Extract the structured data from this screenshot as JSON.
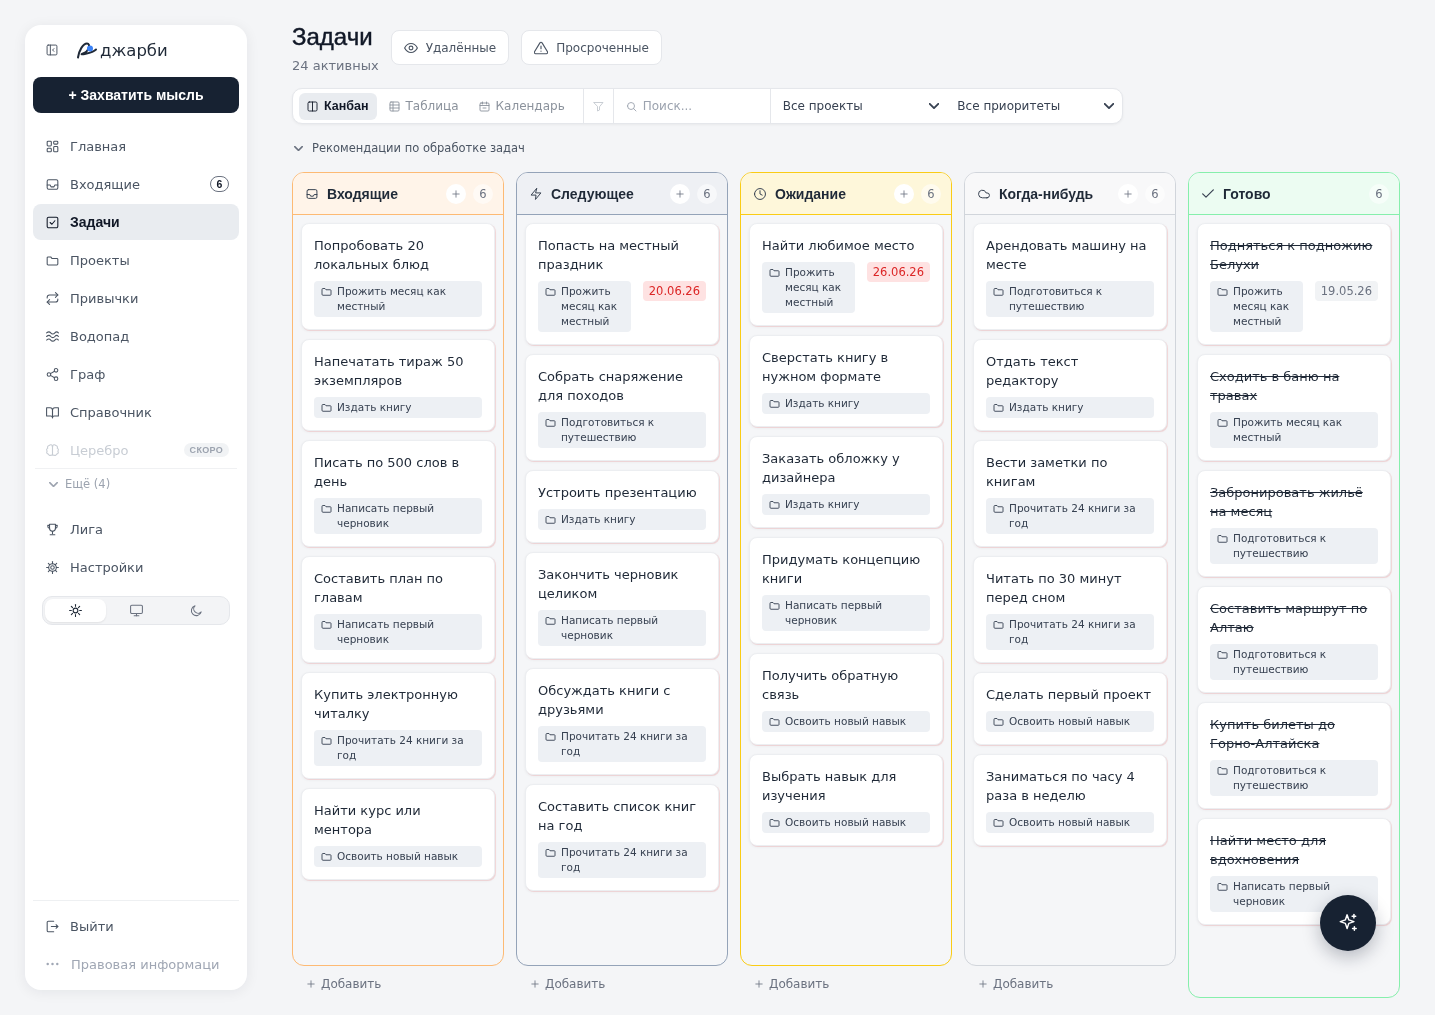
{
  "sidebar": {
    "logo": "джарби",
    "capture_button": "+ Захватить мысль",
    "nav": [
      {
        "label": "Главная",
        "selected": false,
        "disabled": false
      },
      {
        "label": "Входящие",
        "selected": false,
        "disabled": false,
        "count": "6"
      },
      {
        "label": "Задачи",
        "selected": true,
        "disabled": false
      },
      {
        "label": "Проекты",
        "selected": false,
        "disabled": false
      },
      {
        "label": "Привычки",
        "selected": false,
        "disabled": false
      },
      {
        "label": "Водопад",
        "selected": false,
        "disabled": false
      },
      {
        "label": "Граф",
        "selected": false,
        "disabled": false
      },
      {
        "label": "Справочник",
        "selected": false,
        "disabled": false
      },
      {
        "label": "Церебро",
        "selected": false,
        "disabled": true,
        "tag": "СКОРО"
      }
    ],
    "more": {
      "label": "Ещё (4)",
      "expanded": false
    },
    "secondary_nav": [
      {
        "label": "Лига",
        "selected": false
      },
      {
        "label": "Настройки",
        "selected": false
      }
    ],
    "theme_switch": [
      {
        "kind": "light",
        "selected": true
      },
      {
        "kind": "system",
        "selected": false
      },
      {
        "kind": "dark",
        "selected": false
      }
    ],
    "footer": [
      {
        "kind": "logout",
        "label": "Выйти"
      },
      {
        "kind": "legal",
        "label": "Правовая информаци"
      }
    ]
  },
  "header": {
    "title": "Задачи",
    "subtitle": "24 активных",
    "buttons": [
      {
        "label": "Удалённые"
      },
      {
        "label": "Просроченные"
      }
    ]
  },
  "toolbar": {
    "views": [
      {
        "label": "Канбан",
        "selected": true
      },
      {
        "label": "Таблица",
        "selected": false
      },
      {
        "label": "Календарь",
        "selected": false
      }
    ],
    "search": {
      "placeholder": "Поиск..."
    },
    "filters": [
      {
        "value": "Все проекты"
      },
      {
        "value": "Все приоритеты"
      }
    ]
  },
  "recommendations": {
    "label": "Рекомендации по обработке задач",
    "expanded": false
  },
  "columns": [
    {
      "title": "Входящие",
      "count": "6",
      "color": "#fdba74",
      "addable": true,
      "add_label": "Добавить",
      "cards": [
        {
          "title": "Попробовать 20 локальных блюд",
          "project": "Прожить месяц как местный",
          "done": false
        },
        {
          "title": "Напечатать тираж 50 экземпляров",
          "project": "Издать книгу",
          "done": false
        },
        {
          "title": "Писать по 500 слов в день",
          "project": "Написать первый черновик",
          "done": false
        },
        {
          "title": "Составить план по главам",
          "project": "Написать первый черновик",
          "done": false
        },
        {
          "title": "Купить электронную читалку",
          "project": "Прочитать 24 книги за год",
          "done": false
        },
        {
          "title": "Найти курс или ментора",
          "project": "Освоить новый навык",
          "done": false
        }
      ]
    },
    {
      "title": "Следующее",
      "count": "6",
      "color": "#94a3b8",
      "addable": true,
      "add_label": "Добавить",
      "cards": [
        {
          "title": "Попасть на местный праздник",
          "project": "Прожить месяц как местный",
          "done": false,
          "due": {
            "date": "20.06.26",
            "overdue": true
          }
        },
        {
          "title": "Собрать снаряжение для походов",
          "project": "Подготовиться к путешествию",
          "done": false
        },
        {
          "title": "Устроить презентацию",
          "project": "Издать книгу",
          "done": false
        },
        {
          "title": "Закончить черновик целиком",
          "project": "Написать первый черновик",
          "done": false
        },
        {
          "title": "Обсуждать книги с друзьями",
          "project": "Прочитать 24 книги за год",
          "done": false
        },
        {
          "title": "Составить список книг на год",
          "project": "Прочитать 24 книги за год",
          "done": false
        }
      ]
    },
    {
      "title": "Ожидание",
      "count": "6",
      "color": "#facc15",
      "addable": true,
      "add_label": "Добавить",
      "cards": [
        {
          "title": "Найти любимое место",
          "project": "Прожить месяц как местный",
          "done": false,
          "due": {
            "date": "26.06.26",
            "overdue": true
          }
        },
        {
          "title": "Сверстать книгу в нужном формате",
          "project": "Издать книгу",
          "done": false
        },
        {
          "title": "Заказать обложку у дизайнера",
          "project": "Издать книгу",
          "done": false
        },
        {
          "title": "Придумать концепцию книги",
          "project": "Написать первый черновик",
          "done": false
        },
        {
          "title": "Получить обратную связь",
          "project": "Освоить новый навык",
          "done": false
        },
        {
          "title": "Выбрать навык для изучения",
          "project": "Освоить новый навык",
          "done": false
        }
      ]
    },
    {
      "title": "Когда-нибудь",
      "count": "6",
      "color": "#d1d5db",
      "addable": true,
      "add_label": "Добавить",
      "cards": [
        {
          "title": "Арендовать машину на месте",
          "project": "Подготовиться к путешествию",
          "done": false
        },
        {
          "title": "Отдать текст редактору",
          "project": "Издать книгу",
          "done": false
        },
        {
          "title": "Вести заметки по книгам",
          "project": "Прочитать 24 книги за год",
          "done": false
        },
        {
          "title": "Читать по 30 минут перед сном",
          "project": "Прочитать 24 книги за год",
          "done": false
        },
        {
          "title": "Сделать первый проект",
          "project": "Освоить новый навык",
          "done": false
        },
        {
          "title": "Заниматься по часу 4 раза в неделю",
          "project": "Освоить новый навык",
          "done": false
        }
      ]
    },
    {
      "title": "Готово",
      "count": "6",
      "color": "#86efac",
      "addable": false,
      "cards": [
        {
          "title": "Подняться к подножию Белухи",
          "project": "Прожить месяц как местный",
          "done": true,
          "due": {
            "date": "19.05.26",
            "overdue": false
          }
        },
        {
          "title": "Сходить в баню на травах",
          "project": "Прожить месяц как местный",
          "done": true
        },
        {
          "title": "Забронировать жильё на месяц",
          "project": "Подготовиться к путешествию",
          "done": true
        },
        {
          "title": "Составить маршрут по Алтаю",
          "project": "Подготовиться к путешествию",
          "done": true
        },
        {
          "title": "Купить билеты до Горно-Алтайска",
          "project": "Подготовиться к путешествию",
          "done": true
        },
        {
          "title": "Найти место для вдохновения",
          "project": "Написать первый черновик",
          "done": true
        }
      ]
    }
  ]
}
